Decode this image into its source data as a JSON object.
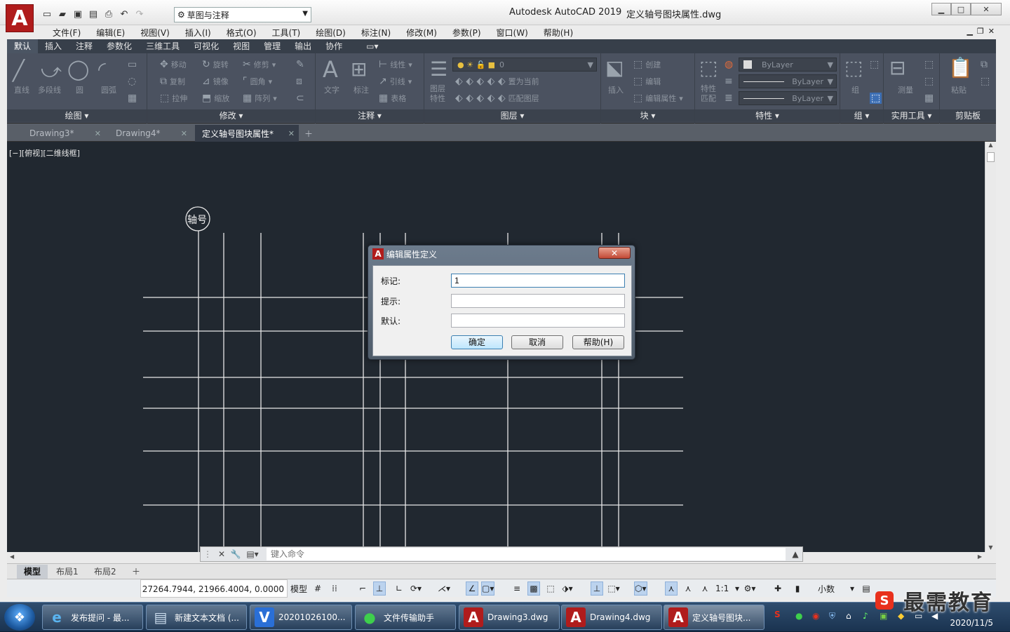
{
  "titlebar": {
    "app_logo": "A",
    "workspace": "草图与注释",
    "app_title": "Autodesk AutoCAD 2019",
    "doc_title": "定义轴号图块属性.dwg"
  },
  "menubar": [
    "文件(F)",
    "编辑(E)",
    "视图(V)",
    "插入(I)",
    "格式(O)",
    "工具(T)",
    "绘图(D)",
    "标注(N)",
    "修改(M)",
    "参数(P)",
    "窗口(W)",
    "帮助(H)"
  ],
  "ribbon": {
    "tabs": [
      "默认",
      "插入",
      "注释",
      "参数化",
      "三维工具",
      "可视化",
      "视图",
      "管理",
      "输出",
      "协作"
    ],
    "active_tab": "默认",
    "panels": {
      "draw": {
        "title": "绘图",
        "items": [
          "直线",
          "多段线",
          "圆",
          "圆弧"
        ]
      },
      "modify": {
        "title": "修改",
        "items": [
          "移动",
          "旋转",
          "修剪",
          "复制",
          "镜像",
          "圆角",
          "拉伸",
          "缩放",
          "阵列"
        ]
      },
      "annotation": {
        "title": "注释",
        "items": [
          "文字",
          "标注",
          "线性",
          "引线",
          "表格"
        ]
      },
      "layers": {
        "title": "图层",
        "layer_value": "0",
        "items": [
          "图层特性",
          "置为当前",
          "匹配图层"
        ]
      },
      "block": {
        "title": "块",
        "items": [
          "插入",
          "创建",
          "编辑",
          "编辑属性"
        ]
      },
      "properties": {
        "title": "特性",
        "items": [
          "特性匹配"
        ],
        "color": "ByLayer",
        "linetype": "ByLayer",
        "lineweight": "ByLayer"
      },
      "groups": {
        "title": "组",
        "items": [
          "组"
        ]
      },
      "utilities": {
        "title": "实用工具",
        "items": [
          "测量"
        ]
      },
      "clipboard": {
        "title": "剪贴板",
        "items": [
          "粘贴"
        ]
      }
    }
  },
  "doc_tabs": [
    {
      "label": "Drawing3*",
      "active": false
    },
    {
      "label": "Drawing4*",
      "active": false
    },
    {
      "label": "定义轴号图块属性*",
      "active": true
    }
  ],
  "canvas": {
    "view_label": "[−][俯视][二维线框]",
    "axis_label": "轴号"
  },
  "command": {
    "placeholder": "键入命令"
  },
  "layout_tabs": [
    "模型",
    "布局1",
    "布局2"
  ],
  "status": {
    "coords": "27264.7944, 21966.4004, 0.0000",
    "model": "模型",
    "scale": "1:1",
    "units": "小数"
  },
  "dialog": {
    "title": "编辑属性定义",
    "close": "✕",
    "fields": [
      {
        "label": "标记:",
        "value": "1"
      },
      {
        "label": "提示:",
        "value": ""
      },
      {
        "label": "默认:",
        "value": ""
      }
    ],
    "buttons": {
      "ok": "确定",
      "cancel": "取消",
      "help": "帮助(H)"
    }
  },
  "taskbar": {
    "items": [
      "发布提问 - 最...",
      "新建文本文档 (...",
      "20201026100...",
      "文件传输助手",
      "Drawing3.dwg",
      "Drawing4.dwg",
      "定义轴号图块..."
    ],
    "date": "2020/11/5"
  },
  "watermark": {
    "badge": "S",
    "text": "最需教育"
  }
}
